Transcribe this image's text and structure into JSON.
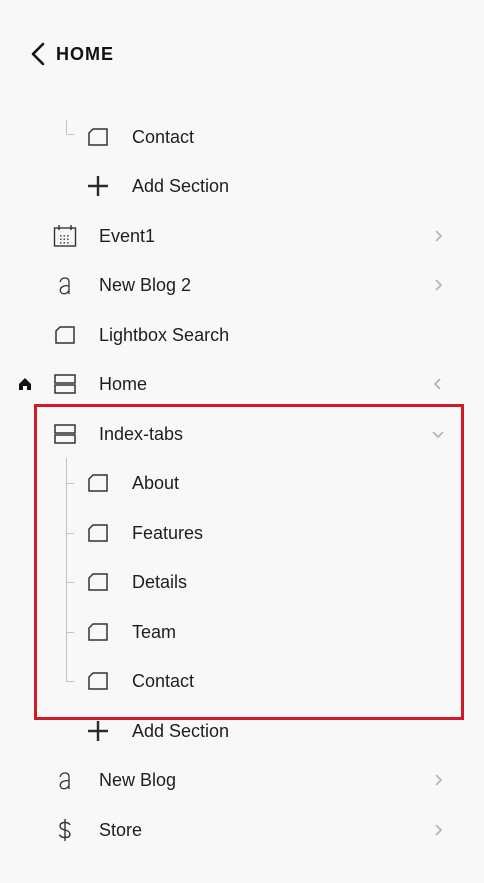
{
  "header": {
    "back_label": "HOME"
  },
  "nav": {
    "first_group": {
      "contact_label": "Contact",
      "add_section_label": "Add Section"
    },
    "event1_label": "Event1",
    "new_blog_2_label": "New Blog 2",
    "lightbox_search_label": "Lightbox Search",
    "home_label": "Home",
    "index_tabs": {
      "label": "Index-tabs",
      "sections": [
        "About",
        "Features",
        "Details",
        "Team",
        "Contact"
      ]
    },
    "add_section_label": "Add Section",
    "new_blog_label": "New Blog",
    "store_label": "Store"
  },
  "colors": {
    "highlight_border": "#d21a24",
    "background": "#f8f8f8",
    "tree_line": "#c4c4c4"
  },
  "icons": {
    "back": "chevron-left-icon",
    "page": "page-icon",
    "add": "plus-icon",
    "calendar": "calendar-icon",
    "blog": "blog-icon",
    "index": "index-icon",
    "store": "dollar-icon",
    "home": "home-icon"
  }
}
